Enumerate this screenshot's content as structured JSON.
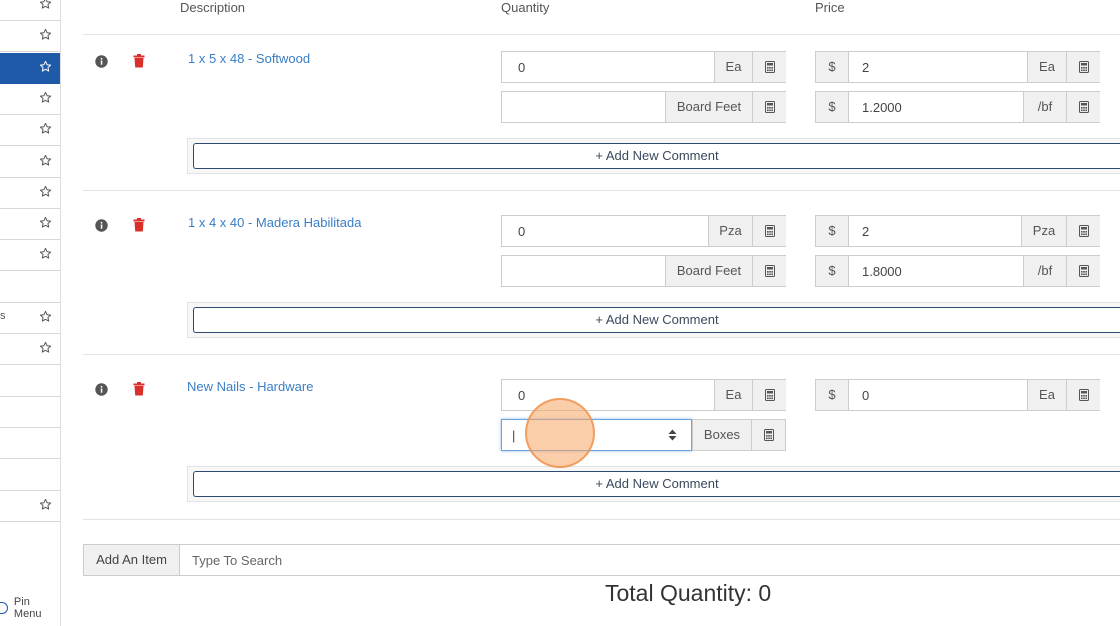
{
  "sidebar": {
    "rows": [
      {
        "label": "",
        "starred": true,
        "active": false
      },
      {
        "label": "",
        "starred": true,
        "active": false
      },
      {
        "label": "",
        "starred": true,
        "active": true
      },
      {
        "label": "",
        "starred": true,
        "active": false
      },
      {
        "label": "",
        "starred": true,
        "active": false
      },
      {
        "label": "",
        "starred": true,
        "active": false
      },
      {
        "label": "",
        "starred": true,
        "active": false
      },
      {
        "label": "",
        "starred": true,
        "active": false
      },
      {
        "label": "",
        "starred": true,
        "active": false
      },
      {
        "label": "",
        "starred": false,
        "active": false
      },
      {
        "label": "s",
        "starred": true,
        "active": false
      },
      {
        "label": "",
        "starred": true,
        "active": false
      },
      {
        "label": "",
        "starred": false,
        "active": false
      },
      {
        "label": "",
        "starred": false,
        "active": false
      },
      {
        "label": "",
        "starred": false,
        "active": false
      },
      {
        "label": "",
        "starred": false,
        "active": false
      },
      {
        "label": "",
        "starred": true,
        "active": false
      }
    ],
    "pin_menu_label": "Pin Menu"
  },
  "table": {
    "headers": {
      "description": "Description",
      "quantity": "Quantity",
      "price": "Price"
    },
    "items": [
      {
        "name": "1 x 5 x 48 - Softwood",
        "qty": {
          "value": "0",
          "unit": "Ea"
        },
        "qty2": {
          "value": "",
          "unit": "Board Feet"
        },
        "price": {
          "currency": "$",
          "value": "2",
          "unit": "Ea"
        },
        "price2": {
          "currency": "$",
          "value": "1.2000",
          "unit": "/bf"
        },
        "comment_label": "+ Add New Comment"
      },
      {
        "name": "1 x 4 x 40 - Madera Habilitada",
        "qty": {
          "value": "0",
          "unit": "Pza"
        },
        "qty2": {
          "value": "",
          "unit": "Board Feet"
        },
        "price": {
          "currency": "$",
          "value": "2",
          "unit": "Pza"
        },
        "price2": {
          "currency": "$",
          "value": "1.8000",
          "unit": "/bf"
        },
        "comment_label": "+ Add New Comment"
      },
      {
        "name": "New Nails - Hardware",
        "qty": {
          "value": "0",
          "unit": "Ea"
        },
        "qty2": {
          "value": "|",
          "unit": "Boxes"
        },
        "price": {
          "currency": "$",
          "value": "0",
          "unit": "Ea"
        },
        "comment_label": "+ Add New Comment"
      }
    ]
  },
  "add_item": {
    "button_label": "Add An Item",
    "search_placeholder": "Type To Search"
  },
  "total": {
    "label": "Total Quantity",
    "value": "0"
  },
  "colors": {
    "link": "#3a7ec6",
    "delete": "#d9302c",
    "active_nav": "#1e5aa8",
    "cursor_highlight": "#f7a564"
  }
}
